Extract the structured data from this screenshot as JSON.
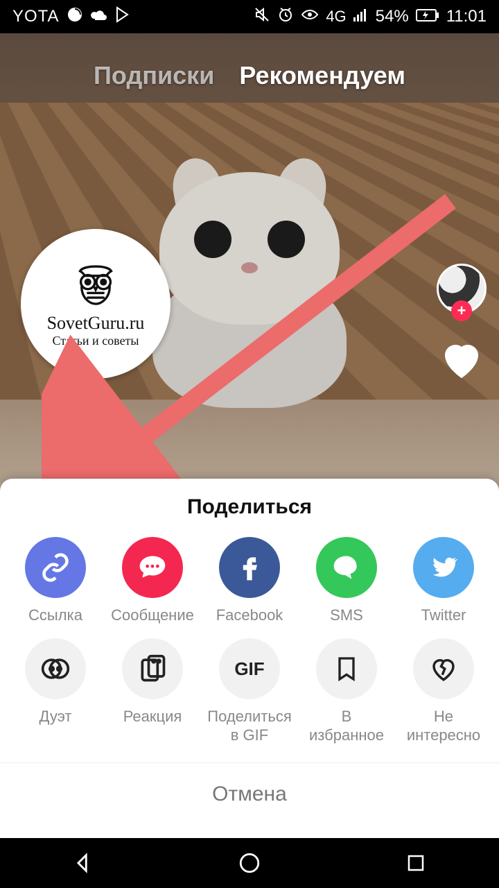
{
  "status": {
    "carrier": "YOTA",
    "battery_pct": "54%",
    "time": "11:01",
    "net": "4G"
  },
  "tabs": {
    "following": "Подписки",
    "recommended": "Рекомендуем"
  },
  "watermark": {
    "title": "SovetGuru.ru",
    "subtitle": "Статьи и советы"
  },
  "share": {
    "title": "Поделиться",
    "row1": [
      {
        "id": "link",
        "label": "Ссылка"
      },
      {
        "id": "message",
        "label": "Сообщение"
      },
      {
        "id": "facebook",
        "label": "Facebook"
      },
      {
        "id": "sms",
        "label": "SMS"
      },
      {
        "id": "twitter",
        "label": "Twitter"
      }
    ],
    "row2": [
      {
        "id": "duet",
        "label": "Дуэт"
      },
      {
        "id": "reaction",
        "label": "Реакция"
      },
      {
        "id": "share-gif",
        "label": "Поделиться\nв GIF",
        "text": "GIF"
      },
      {
        "id": "favorite",
        "label": "В\nизбранное"
      },
      {
        "id": "not-interested",
        "label": "Не\nинтересно"
      }
    ],
    "cancel": "Отмена"
  },
  "colors": {
    "link": "#6477e5",
    "message": "#f42750",
    "facebook": "#3b5998",
    "sms": "#34c759",
    "twitter": "#55acee",
    "arrow": "#ec6b6b",
    "accent_plus": "#fe2c55"
  }
}
